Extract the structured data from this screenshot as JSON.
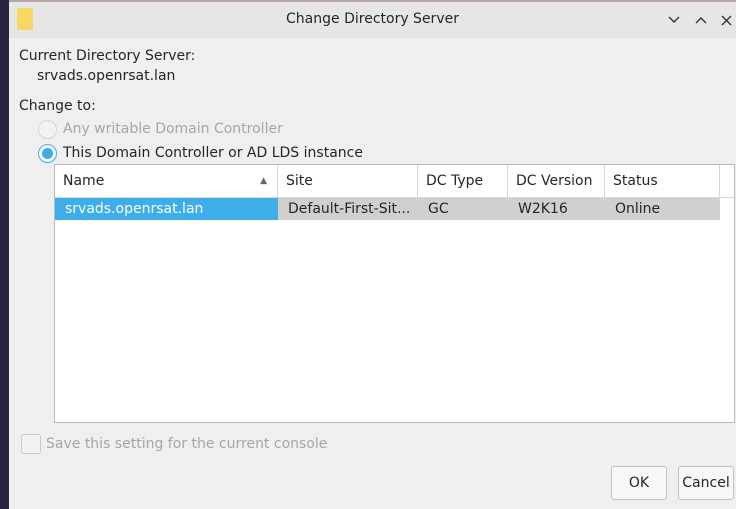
{
  "window": {
    "title": "Change Directory Server",
    "controls": [
      "chevron-down-icon",
      "chevron-up-icon",
      "close-icon"
    ]
  },
  "current": {
    "label": "Current Directory Server:",
    "value": "srvads.openrsat.lan"
  },
  "change_to": {
    "label": "Change to:",
    "options": [
      {
        "label": "Any writable Domain Controller",
        "checked": false,
        "enabled": false
      },
      {
        "label": "This Domain Controller or AD LDS instance",
        "checked": true,
        "enabled": true
      }
    ]
  },
  "table": {
    "columns": [
      "Name",
      "Site",
      "DC Type",
      "DC Version",
      "Status"
    ],
    "sort_column": "Name",
    "sort_direction": "ascending",
    "rows": [
      {
        "name": "srvads.openrsat.lan",
        "site": "Default-First-Sit...",
        "dc_type": "GC",
        "dc_version": "W2K16",
        "status": "Online",
        "selected": true
      }
    ]
  },
  "save_setting": {
    "label": "Save this setting for the current console",
    "checked": false,
    "enabled": false
  },
  "buttons": {
    "ok": "OK",
    "cancel": "Cancel"
  },
  "colors": {
    "accent": "#3daee9",
    "window_bg": "#efefef",
    "titlebar_bg": "#e6e6e6",
    "disabled_text": "#a4a7aa",
    "row_bg": "#d0d0d0"
  }
}
